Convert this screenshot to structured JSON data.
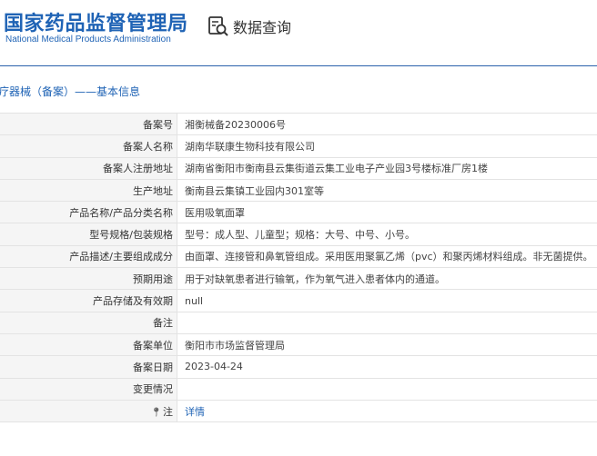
{
  "header": {
    "logo_cn": "国家药品监督管理局",
    "logo_en": "National Medical Products Administration",
    "query_label": "数据查询",
    "query_icon": "search-document-icon"
  },
  "breadcrumb": {
    "category": "医疗器械（备案）",
    "separator": "——",
    "current": "基本信息"
  },
  "rows": [
    {
      "label": "备案号",
      "value": "湘衡械备20230006号"
    },
    {
      "label": "备案人名称",
      "value": "湖南华联康生物科技有限公司"
    },
    {
      "label": "备案人注册地址",
      "value": "湖南省衡阳市衡南县云集街道云集工业电子产业园3号楼标准厂房1楼"
    },
    {
      "label": "生产地址",
      "value": "衡南县云集镇工业园内301室等"
    },
    {
      "label": "产品名称/产品分类名称",
      "value": "医用吸氧面罩"
    },
    {
      "label": "型号规格/包装规格",
      "value": "型号：成人型、儿童型；规格：大号、中号、小号。"
    },
    {
      "label": "产品描述/主要组成成分",
      "value": "由面罩、连接管和鼻氧管组成。采用医用聚氯乙烯（pvc）和聚丙烯材料组成。非无菌提供。"
    },
    {
      "label": "预期用途",
      "value": "用于对缺氧患者进行输氧，作为氧气进入患者体内的通道。"
    },
    {
      "label": "产品存储及有效期",
      "value": "null"
    },
    {
      "label": "备注",
      "value": ""
    },
    {
      "label": "备案单位",
      "value": "衡阳市市场监督管理局"
    },
    {
      "label": "备案日期",
      "value": "2023-04-24"
    },
    {
      "label": "变更情况",
      "value": ""
    }
  ],
  "note_row": {
    "label": "注",
    "value": "详情",
    "icon": "location-pin-icon"
  },
  "colors": {
    "brand_blue": "#1f63b5",
    "label_bg": "#f5f5f5",
    "border": "#e3e3e3"
  }
}
